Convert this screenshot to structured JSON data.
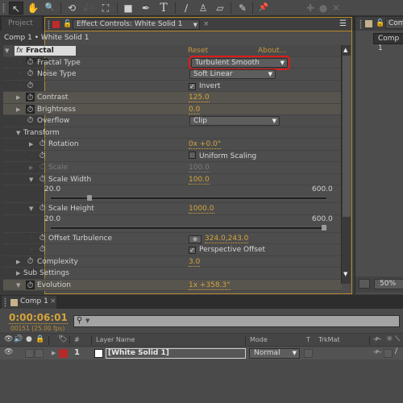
{
  "toolbar": {
    "tools": [
      {
        "icon": "selection-tool-icon",
        "glyph": "↖",
        "active": true
      },
      {
        "icon": "hand-tool-icon",
        "glyph": "✋",
        "active": false
      },
      {
        "icon": "zoom-tool-icon",
        "glyph": "🔍",
        "active": false
      },
      {
        "icon": "rotation-tool-icon",
        "glyph": "⟲",
        "active": false
      },
      {
        "icon": "camera-tool-icon",
        "glyph": "🎥",
        "active": false
      },
      {
        "icon": "pan-behind-tool-icon",
        "glyph": "⛶",
        "active": false
      },
      {
        "icon": "rectangle-tool-icon",
        "glyph": "■",
        "active": false
      },
      {
        "icon": "pen-tool-icon",
        "glyph": "✒",
        "active": false
      },
      {
        "icon": "type-tool-icon",
        "glyph": "T",
        "active": false
      },
      {
        "icon": "brush-tool-icon",
        "glyph": "∕",
        "active": false
      },
      {
        "icon": "clone-stamp-tool-icon",
        "glyph": "♙",
        "active": false
      },
      {
        "icon": "eraser-tool-icon",
        "glyph": "▱",
        "active": false
      },
      {
        "icon": "roto-brush-tool-icon",
        "glyph": "✎",
        "active": false
      },
      {
        "icon": "puppet-pin-tool-icon",
        "glyph": "📌",
        "active": false
      }
    ],
    "dim_tools": [
      "✚",
      "●",
      "✕"
    ]
  },
  "panels": {
    "project_tab": "Project",
    "effect_controls_tab": "Effect Controls: White Solid 1",
    "comp_crumb": "Comp 1 • White Solid 1",
    "right_tab": "Comp",
    "right_crumb": "Comp 1",
    "right_zoom": "50%"
  },
  "effect": {
    "name": "Fractal Noise",
    "fx_badge": "fx",
    "reset": "Reset",
    "about": "About...",
    "fractal_type_label": "Fractal Type",
    "fractal_type_value": "Turbulent Smooth",
    "noise_type_label": "Noise Type",
    "noise_type_value": "Soft Linear",
    "invert_label": "Invert",
    "invert_checked": true,
    "contrast_label": "Contrast",
    "contrast_value": "125.0",
    "brightness_label": "Brightness",
    "brightness_value": "0.0",
    "overflow_label": "Overflow",
    "overflow_value": "Clip",
    "transform_label": "Transform",
    "rotation_label": "Rotation",
    "rotation_value": "0x +0.0°",
    "uniform_scaling_label": "Uniform Scaling",
    "uniform_scaling_checked": false,
    "scale_label": "Scale",
    "scale_value": "100.0",
    "scale_width_label": "Scale Width",
    "scale_width_value": "100.0",
    "scale_width_min": "20.0",
    "scale_width_max": "600.0",
    "scale_width_fraction": 0.14,
    "scale_height_label": "Scale Height",
    "scale_height_value": "1000.0",
    "scale_height_min": "20.0",
    "scale_height_max": "600.0",
    "scale_height_fraction": 1.0,
    "offset_turbulence_label": "Offset Turbulence",
    "offset_turbulence_value": "324.0,243.0",
    "perspective_offset_label": "Perspective Offset",
    "perspective_offset_checked": true,
    "complexity_label": "Complexity",
    "complexity_value": "3.0",
    "sub_settings_label": "Sub Settings",
    "evolution_label": "Evolution",
    "evolution_value": "1x +358.3°"
  },
  "timeline": {
    "tab": "Comp 1",
    "timecode": "0:00:06:01",
    "frames": "00151 (25.00 fps)",
    "columns": {
      "hash": "#",
      "layer_name": "Layer Name",
      "mode": "Mode",
      "t": "T",
      "trkmat": "TrkMat"
    },
    "layers": [
      {
        "number": "1",
        "name": "[White Solid 1]",
        "mode": "Normal",
        "label_color": "#b52a2a"
      }
    ]
  }
}
